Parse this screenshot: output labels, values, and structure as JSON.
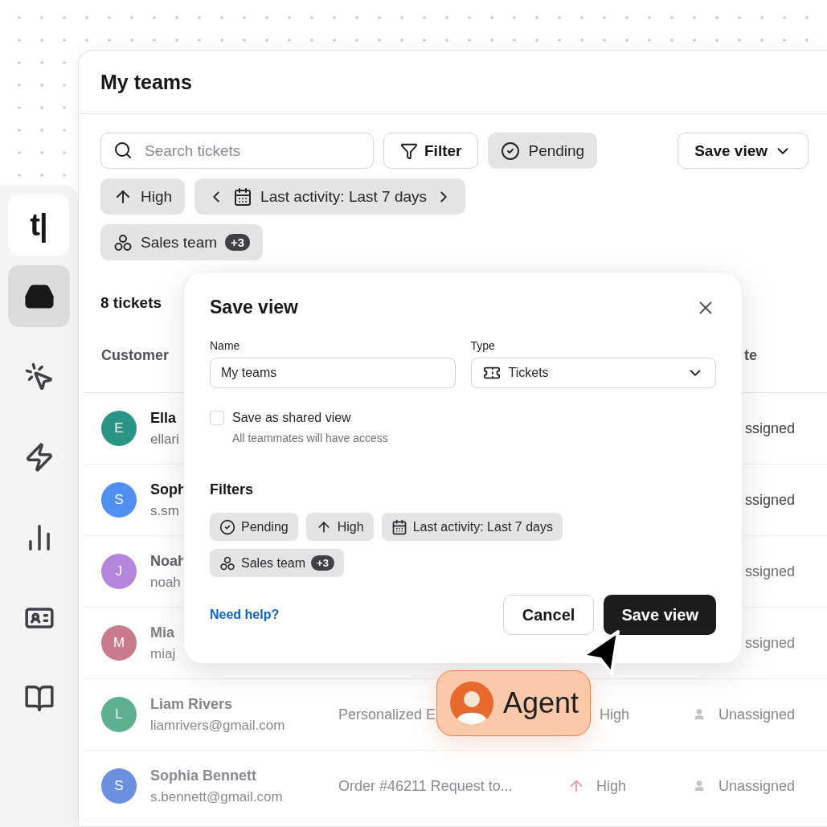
{
  "sidebar": {
    "logo": "t|",
    "items": [
      {
        "selected": true
      },
      {
        "selected": false
      },
      {
        "selected": false
      },
      {
        "selected": false
      },
      {
        "selected": false
      },
      {
        "selected": false
      }
    ]
  },
  "page": {
    "title": "My teams",
    "search": {
      "placeholder": "Search tickets"
    },
    "filter_button": "Filter",
    "save_view_button": "Save view",
    "chips": [
      {
        "kind": "status",
        "label": "Pending"
      },
      {
        "kind": "priority",
        "label": "High"
      },
      {
        "kind": "date",
        "label": "Last activity: Last 7 days"
      },
      {
        "kind": "team",
        "label": "Sales team",
        "count": "+3"
      }
    ],
    "ticket_count": "8 tickets"
  },
  "table": {
    "columns": [
      "Customer",
      "te"
    ],
    "rows": [
      {
        "initial": "E",
        "color": "#2a9485",
        "name": "Ella",
        "email": "ellari",
        "assignee": "ssigned"
      },
      {
        "initial": "S",
        "color": "#4f8ff0",
        "name": "Soph",
        "email": "s.sm",
        "assignee": "ssigned"
      },
      {
        "initial": "J",
        "color": "#b385dd",
        "name": "Noah",
        "email": "noah",
        "assignee": "ssigned"
      },
      {
        "initial": "M",
        "color": "#c97b8c",
        "name": "Mia",
        "email": "miaj",
        "assignee": "ssigned"
      },
      {
        "initial": "L",
        "color": "#5daf90",
        "name": "Liam Rivers",
        "email": "liamrivers@gmail.com",
        "subject": "Personalized E",
        "priority": "High",
        "assignee": "Unassigned"
      },
      {
        "initial": "S",
        "color": "#6c90e0",
        "name": "Sophia Bennett",
        "email": "s.bennett@gmail.com",
        "subject": "Order #46211 Request to...",
        "priority": "High",
        "priority_arrow": true,
        "assignee": "Unassigned"
      }
    ]
  },
  "dialog": {
    "title": "Save view",
    "name_label": "Name",
    "name_value": "My teams",
    "type_label": "Type",
    "type_value": "Tickets",
    "shared": {
      "label": "Save as shared view",
      "checked": false,
      "hint": "All teammates will have access"
    },
    "filters_heading": "Filters",
    "filters": [
      {
        "kind": "status",
        "label": "Pending"
      },
      {
        "kind": "priority",
        "label": "High"
      },
      {
        "kind": "date",
        "label": "Last activity: Last 7 days"
      },
      {
        "kind": "team",
        "label": "Sales team",
        "count": "+3"
      }
    ],
    "help_link": "Need help?",
    "cancel_button": "Cancel",
    "save_button": "Save view"
  },
  "agent": {
    "label": "Agent"
  }
}
